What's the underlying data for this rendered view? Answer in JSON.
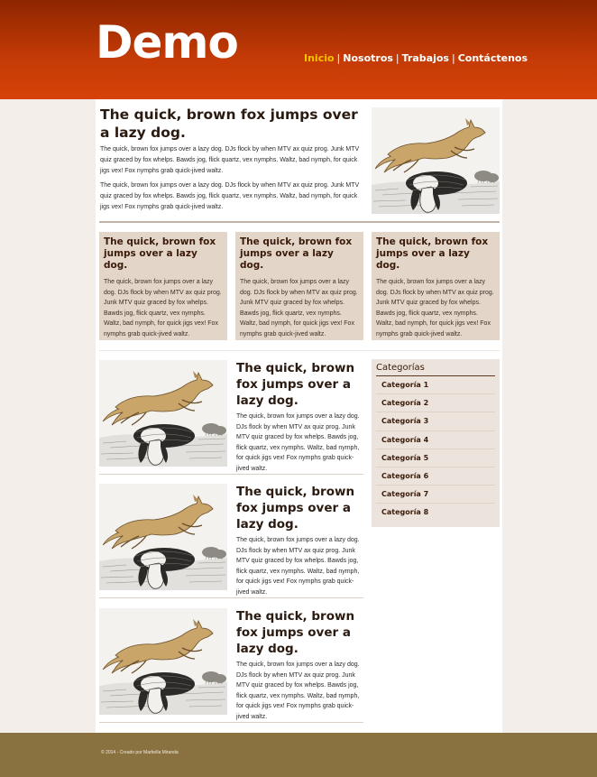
{
  "header": {
    "logo": "Demo",
    "nav": [
      {
        "label": "Inicio",
        "active": true
      },
      {
        "label": "Nosotros",
        "active": false
      },
      {
        "label": "Trabajos",
        "active": false
      },
      {
        "label": "Contáctenos",
        "active": false
      }
    ],
    "separator": "|"
  },
  "hero": {
    "title": "The quick, brown fox jumps over a lazy dog.",
    "paragraphs": [
      "The quick, brown fox jumps over a lazy dog. DJs flock by when MTV ax quiz prog. Junk MTV quiz graced by fox whelps. Bawds jog, flick quartz, vex nymphs. Waltz, bad nymph, for quick jigs vex! Fox nymphs grab quick-jived waltz.",
      "The quick, brown fox jumps over a lazy dog. DJs flock by when MTV ax quiz prog. Junk MTV quiz graced by fox whelps. Bawds jog, flick quartz, vex nymphs. Waltz, bad nymph, for quick jigs vex! Fox nymphs grab quick-jived waltz."
    ],
    "image_icon": "fox-jumping-over-dog-illustration"
  },
  "cards": [
    {
      "title": "The quick, brown fox jumps over a lazy dog.",
      "text": "The quick, brown fox jumps over a lazy dog. DJs flock by when MTV ax quiz prog. Junk MTV quiz graced by fox whelps. Bawds jog, flick quartz, vex nymphs. Waltz, bad nymph, for quick jigs vex! Fox nymphs grab quick-jived waltz."
    },
    {
      "title": "The quick, brown fox jumps over a lazy dog.",
      "text": "The quick, brown fox jumps over a lazy dog. DJs flock by when MTV ax quiz prog. Junk MTV quiz graced by fox whelps. Bawds jog, flick quartz, vex nymphs. Waltz, bad nymph, for quick jigs vex! Fox nymphs grab quick-jived waltz."
    },
    {
      "title": "The quick, brown fox jumps over a lazy dog.",
      "text": "The quick, brown fox jumps over a lazy dog. DJs flock by when MTV ax quiz prog. Junk MTV quiz graced by fox whelps. Bawds jog, flick quartz, vex nymphs. Waltz, bad nymph, for quick jigs vex! Fox nymphs grab quick-jived waltz."
    }
  ],
  "posts": [
    {
      "title": "The quick, brown fox jumps over a lazy dog.",
      "text": "The quick, brown fox jumps over a lazy dog. DJs flock by when MTV ax quiz prog. Junk MTV quiz graced by fox whelps. Bawds jog, flick quartz, vex nymphs. Waltz, bad nymph, for quick jigs vex! Fox nymphs grab quick-jived waltz."
    },
    {
      "title": "The quick, brown fox jumps over a lazy dog.",
      "text": "The quick, brown fox jumps over a lazy dog. DJs flock by when MTV ax quiz prog. Junk MTV quiz graced by fox whelps. Bawds jog, flick quartz, vex nymphs. Waltz, bad nymph, for quick jigs vex! Fox nymphs grab quick-jived waltz."
    },
    {
      "title": "The quick, brown fox jumps over a lazy dog.",
      "text": "The quick, brown fox jumps over a lazy dog. DJs flock by when MTV ax quiz prog. Junk MTV quiz graced by fox whelps. Bawds jog, flick quartz, vex nymphs. Waltz, bad nymph, for quick jigs vex! Fox nymphs grab quick-jived waltz."
    }
  ],
  "sidebar": {
    "title": "Categorías",
    "items": [
      "Categoría 1",
      "Categoría 2",
      "Categoría 3",
      "Categoría 4",
      "Categoría 5",
      "Categoría 6",
      "Categoría 7",
      "Categoría 8"
    ]
  },
  "footer": {
    "text": "© 2014 - Creado por Marbella Miranda"
  },
  "colors": {
    "header_top": "#8e2600",
    "header_bottom": "#d64209",
    "nav_active": "#f5c200",
    "card_bg": "#e3d6c9",
    "footer_bg": "#8a7140",
    "page_bg": "#f3eee9"
  }
}
